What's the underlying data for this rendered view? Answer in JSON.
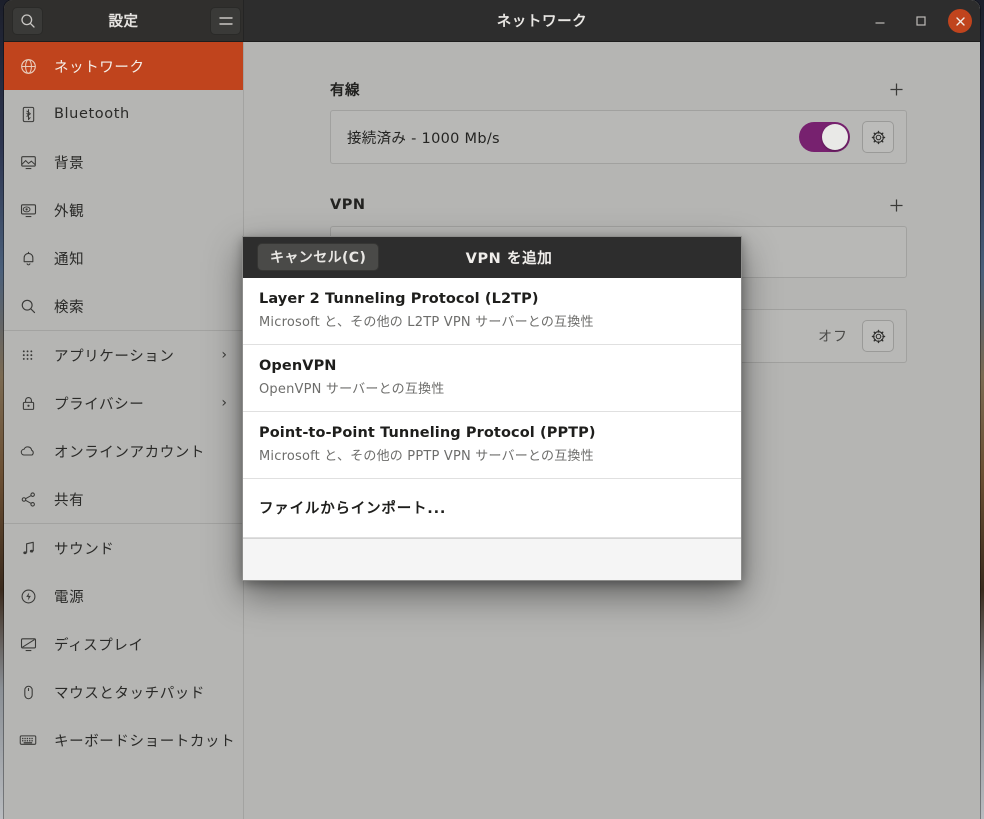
{
  "window": {
    "sidebar_title": "設定",
    "main_title": "ネットワーク",
    "search_icon": "search-icon",
    "menu_icon": "hamburger-menu-icon",
    "minimize_label": "–",
    "maximize_label": "□",
    "close_label": "✕",
    "accent_color": "#c0441d",
    "toggle_on_color": "#77216f"
  },
  "sidebar": {
    "items": [
      {
        "label": "ネットワーク",
        "icon": "globe-icon",
        "selected": true,
        "chevron": ""
      },
      {
        "label": "Bluetooth",
        "icon": "bluetooth-icon",
        "selected": false,
        "chevron": ""
      },
      {
        "label": "背景",
        "icon": "wallpaper-icon",
        "selected": false,
        "chevron": ""
      },
      {
        "label": "外観",
        "icon": "appearance-icon",
        "selected": false,
        "chevron": ""
      },
      {
        "label": "通知",
        "icon": "bell-icon",
        "selected": false,
        "chevron": ""
      },
      {
        "label": "検索",
        "icon": "search-icon",
        "selected": false,
        "chevron": ""
      },
      {
        "label": "アプリケーション",
        "icon": "grid-apps-icon",
        "selected": false,
        "chevron": "›"
      },
      {
        "label": "プライバシー",
        "icon": "lock-icon",
        "selected": false,
        "chevron": "›"
      },
      {
        "label": "オンラインアカウント",
        "icon": "cloud-icon",
        "selected": false,
        "chevron": ""
      },
      {
        "label": "共有",
        "icon": "share-icon",
        "selected": false,
        "chevron": ""
      },
      {
        "label": "サウンド",
        "icon": "music-note-icon",
        "selected": false,
        "chevron": ""
      },
      {
        "label": "電源",
        "icon": "power-icon",
        "selected": false,
        "chevron": ""
      },
      {
        "label": "ディスプレイ",
        "icon": "display-icon",
        "selected": false,
        "chevron": ""
      },
      {
        "label": "マウスとタッチパッド",
        "icon": "mouse-icon",
        "selected": false,
        "chevron": ""
      },
      {
        "label": "キーボードショートカット",
        "icon": "keyboard-icon",
        "selected": false,
        "chevron": ""
      }
    ]
  },
  "main": {
    "wired": {
      "title": "有線",
      "add_icon": "plus-icon",
      "status": "接続済み - 1000 Mb/s",
      "toggle_on": true,
      "settings_icon": "gear-icon"
    },
    "vpn": {
      "title": "VPN",
      "add_icon": "plus-icon"
    },
    "proxy": {
      "state": "オフ",
      "settings_icon": "gear-icon"
    }
  },
  "dialog": {
    "cancel_label": "キャンセル(C)",
    "title": "VPN を追加",
    "items": [
      {
        "name": "Layer 2 Tunneling Protocol (L2TP)",
        "desc": "Microsoft と、その他の L2TP VPN サーバーとの互換性"
      },
      {
        "name": "OpenVPN",
        "desc": "OpenVPN サーバーとの互換性"
      },
      {
        "name": "Point-to-Point Tunneling Protocol (PPTP)",
        "desc": "Microsoft と、その他の PPTP VPN サーバーとの互換性"
      }
    ],
    "import_label": "ファイルからインポート..."
  }
}
